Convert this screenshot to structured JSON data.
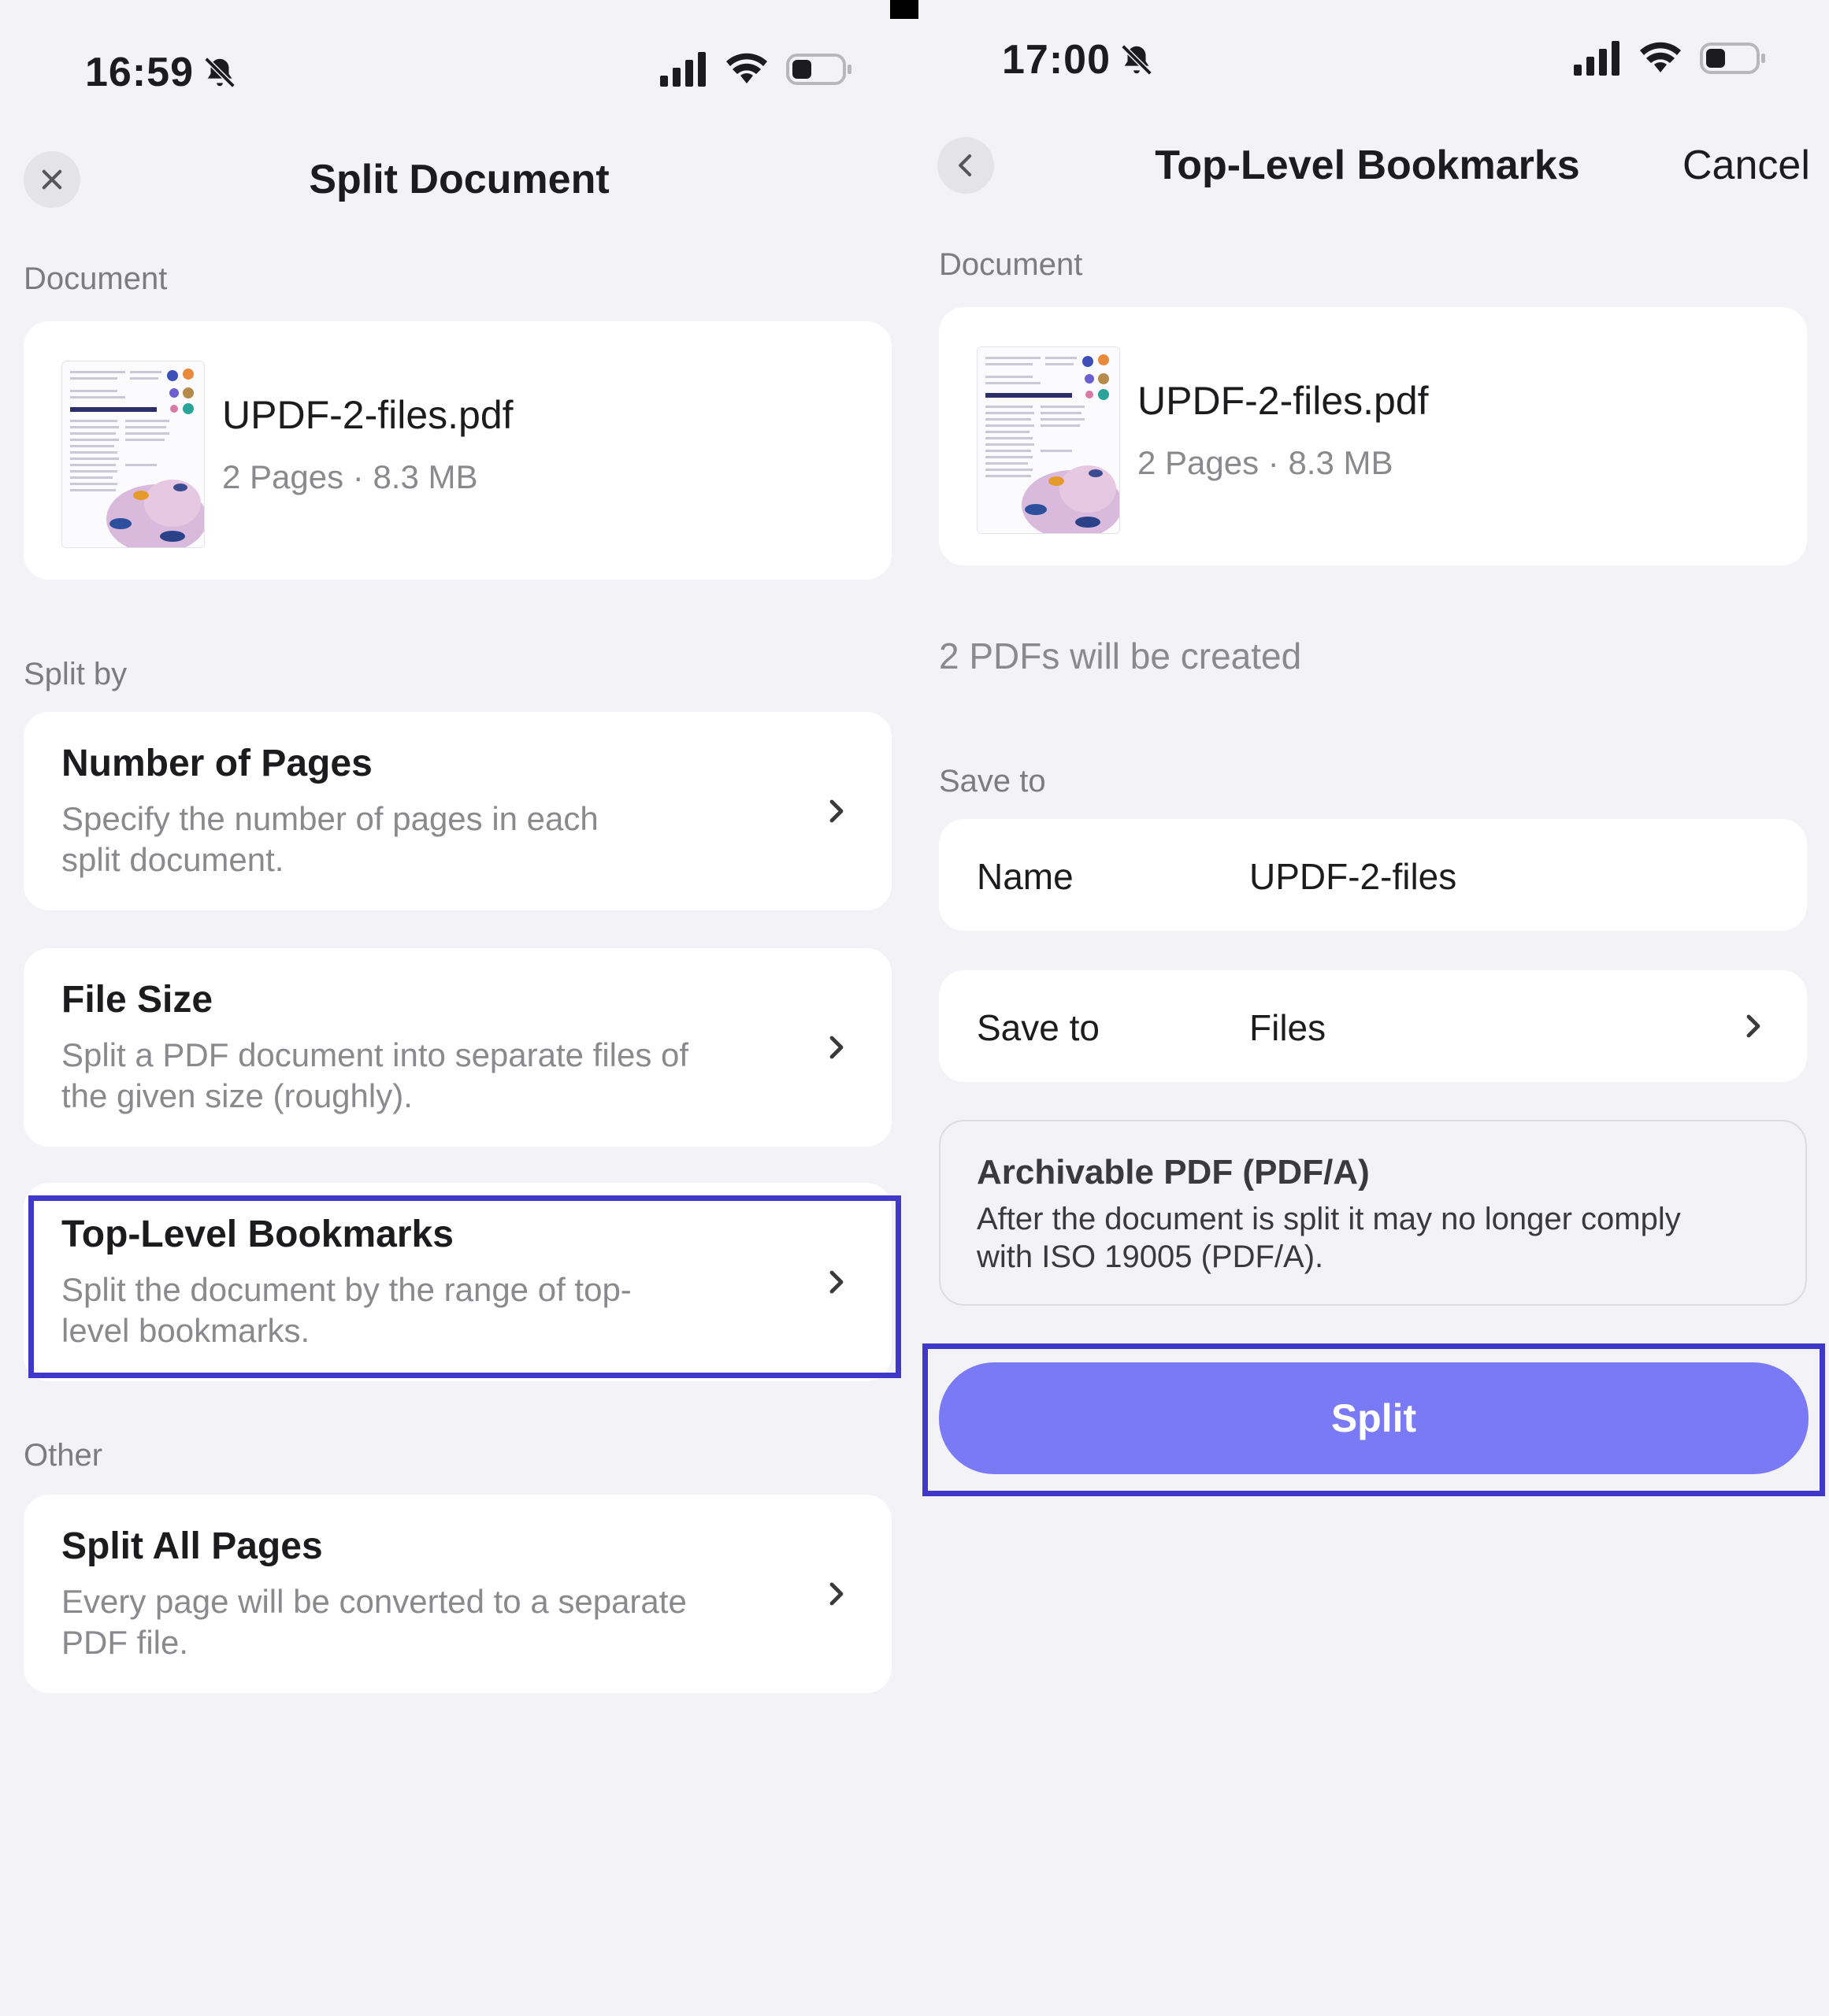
{
  "left": {
    "status": {
      "time": "16:59"
    },
    "title": "Split Document",
    "document_section": "Document",
    "document": {
      "name": "UPDF-2-files.pdf",
      "meta": "2 Pages · 8.3 MB",
      "thumb_title": "Explore the Pacific"
    },
    "split_by_section": "Split by",
    "options": [
      {
        "title": "Number of Pages",
        "desc1": "Specify the number of pages in each",
        "desc2": "split document."
      },
      {
        "title": "File Size",
        "desc1": "Split a PDF document into separate files of",
        "desc2": "the given size (roughly)."
      },
      {
        "title": "Top-Level Bookmarks",
        "desc1": "Split the document by the range of top-",
        "desc2": "level bookmarks."
      }
    ],
    "other_section": "Other",
    "other_option": {
      "title": "Split All Pages",
      "desc1": "Every page will be converted to a separate",
      "desc2": "PDF file."
    }
  },
  "right": {
    "status": {
      "time": "17:00"
    },
    "title": "Top-Level Bookmarks",
    "cancel": "Cancel",
    "document_section": "Document",
    "document": {
      "name": "UPDF-2-files.pdf",
      "meta": "2 Pages · 8.3 MB",
      "thumb_title": "Explore the Pacific"
    },
    "pdfs_created": "2 PDFs will be created",
    "save_section": "Save to",
    "name_row": {
      "label": "Name",
      "value": "UPDF-2-files"
    },
    "saveto_row": {
      "label": "Save to",
      "value": "Files"
    },
    "archive": {
      "title": "Archivable PDF (PDF/A)",
      "desc1": "After the document is split it may no longer comply",
      "desc2": "with ISO 19005 (PDF/A)."
    },
    "split_button": "Split"
  },
  "colors": {
    "accent": "#7a7af7",
    "highlight": "#3f38c9",
    "background": "#f2f2f7"
  }
}
